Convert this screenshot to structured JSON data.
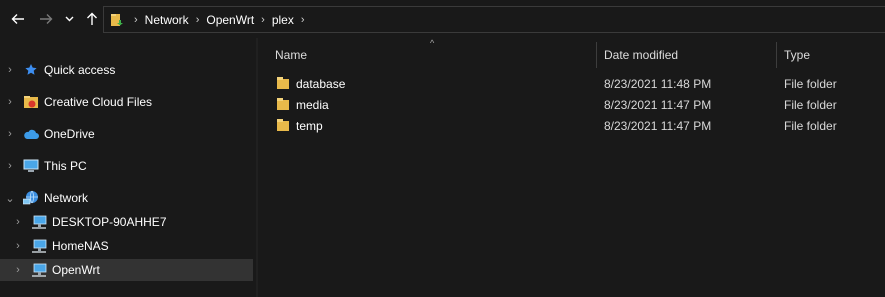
{
  "nav": {
    "back_icon": "arrow-left-icon",
    "forward_icon": "arrow-right-icon",
    "recent_icon": "chevron-down-icon",
    "up_icon": "arrow-up-icon"
  },
  "address": {
    "breadcrumbs": [
      "Network",
      "OpenWrt",
      "plex"
    ]
  },
  "sidebar": {
    "items": [
      {
        "label": "Quick access",
        "icon": "star-icon",
        "expanded": false
      },
      {
        "label": "Creative Cloud Files",
        "icon": "creative-cloud-folder-icon",
        "expanded": false
      },
      {
        "label": "OneDrive",
        "icon": "cloud-icon",
        "expanded": false
      },
      {
        "label": "This PC",
        "icon": "computer-icon",
        "expanded": false
      },
      {
        "label": "Network",
        "icon": "network-icon",
        "expanded": true
      },
      {
        "label": "DESKTOP-90AHHE7",
        "icon": "network-computer-icon",
        "expanded": false
      },
      {
        "label": "HomeNAS",
        "icon": "network-computer-icon",
        "expanded": false
      },
      {
        "label": "OpenWrt",
        "icon": "network-computer-icon",
        "expanded": false,
        "selected": true
      }
    ]
  },
  "columns": {
    "name": "Name",
    "date": "Date modified",
    "type": "Type"
  },
  "files": [
    {
      "name": "database",
      "date": "8/23/2021 11:48 PM",
      "type": "File folder"
    },
    {
      "name": "media",
      "date": "8/23/2021 11:47 PM",
      "type": "File folder"
    },
    {
      "name": "temp",
      "date": "8/23/2021 11:47 PM",
      "type": "File folder"
    }
  ],
  "colors": {
    "background": "#191919",
    "selected": "#333333",
    "folder": "#e8b94a"
  }
}
